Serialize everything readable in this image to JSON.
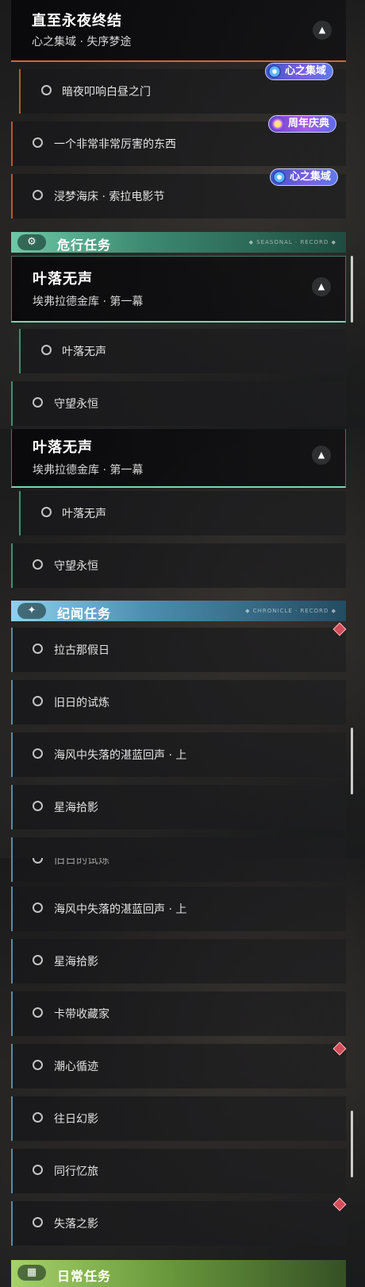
{
  "panel1": {
    "header": {
      "title": "直至永夜终结",
      "subtitle": "心之集域 · 失序梦途",
      "collapse_icon": "▲"
    },
    "rows": [
      "暗夜叩响白昼之门",
      "一个非常非常厉害的东西",
      "浸梦海床 · 索拉电影节"
    ],
    "tags": [
      "心之集域",
      "周年庆典",
      "心之集域"
    ],
    "category": {
      "label": "危行任务",
      "icon": "gear-badge-icon",
      "decoration": "◆ SEASONAL · RECORD ◆"
    },
    "group": {
      "title": "叶落无声",
      "subtitle": "埃弗拉德金库 · 第一幕",
      "collapse_icon": "▲"
    },
    "group_rows": [
      "叶落无声",
      "守望永恒"
    ]
  },
  "panel2": {
    "group": {
      "title": "叶落无声",
      "subtitle": "埃弗拉德金库 · 第一幕",
      "collapse_icon": "▲"
    },
    "group_rows": [
      "叶落无声",
      "守望永恒"
    ],
    "category": {
      "label": "纪闻任务",
      "icon": "sparkle-icon",
      "decoration": "◆ CHRONICLE · RECORD ◆"
    },
    "rows": [
      "拉古那假日",
      "旧日的试炼",
      "海风中失落的湛蓝回声 · 上",
      "星海拾影"
    ]
  },
  "panel3": {
    "partial_row": "旧日的试炼",
    "rows": [
      "海风中失落的湛蓝回声 · 上",
      "星海拾影",
      "卡带收藏家",
      "潮心循迹",
      "往日幻影",
      "同行忆旅",
      "失落之影"
    ],
    "category": {
      "label": "日常任务",
      "icon": "book-icon"
    }
  },
  "colors": {
    "accent_orange": "#c86a3c",
    "danger_green": "#6dc9a8",
    "lore_blue": "#8fd0ee",
    "daily_green": "#a6d16a",
    "alert_red": "#d14d58",
    "event_tag_purple": "#5d7bef"
  }
}
